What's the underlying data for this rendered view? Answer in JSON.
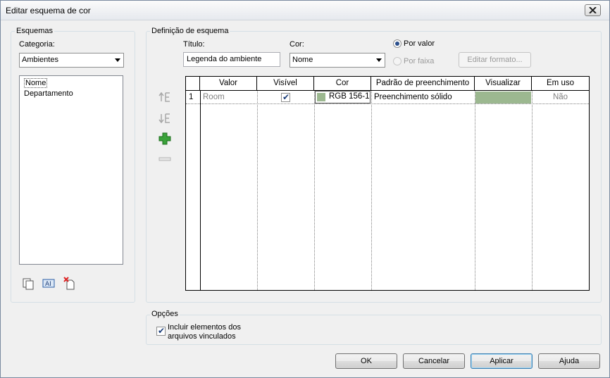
{
  "window": {
    "title": "Editar esquema de cor"
  },
  "schemes": {
    "group_label": "Esquemas",
    "category_label": "Categoria:",
    "category_value": "Ambientes",
    "items": [
      "Nome",
      "Departamento"
    ]
  },
  "definition": {
    "group_label": "Definição de esquema",
    "title_label": "Título:",
    "title_value": "Legenda do ambiente",
    "color_label": "Cor:",
    "color_value": "Nome",
    "by_value_label": "Por valor",
    "by_range_label": "Por faixa",
    "edit_format_label": "Editar formato..."
  },
  "table": {
    "columns": [
      "",
      "Valor",
      "Visível",
      "Cor",
      "Padrão de preenchimento",
      "Visualizar",
      "Em uso"
    ],
    "rows": [
      {
        "index": "1",
        "value": "Room",
        "visible": true,
        "color_text": "RGB 156-1",
        "color_hex": "#9cb890",
        "fill": "Preenchimento sólido",
        "in_use": "Não"
      }
    ]
  },
  "options": {
    "group_label": "Opções",
    "include_linked_label": "Incluir elementos dos arquivos vinculados"
  },
  "buttons": {
    "ok": "OK",
    "cancel": "Cancelar",
    "apply": "Aplicar",
    "help": "Ajuda"
  },
  "colors": {
    "swatch": "#9cb890",
    "accent": "#2b4f8c"
  }
}
